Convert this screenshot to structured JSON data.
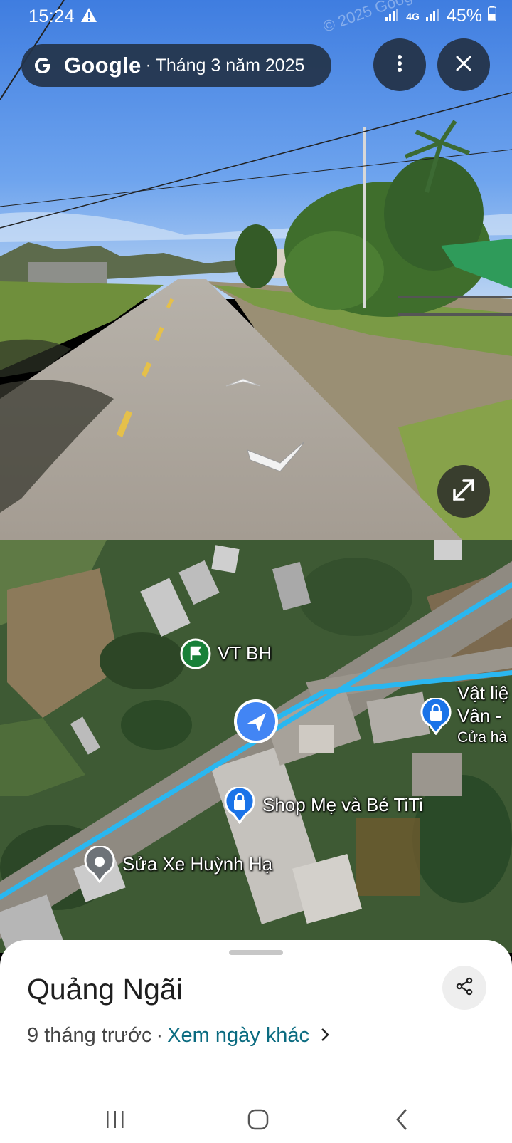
{
  "status_bar": {
    "time": "15:24",
    "battery_percent": "45%",
    "network_label": "4G"
  },
  "street_view": {
    "brand": "Google",
    "separator": "·",
    "capture_date": "Tháng 3 năm 2025",
    "watermark": "© 2025 Google",
    "controls": {
      "more_icon": "more-vert-icon",
      "close_icon": "close-icon",
      "expand_icon": "expand-icon"
    }
  },
  "map": {
    "route_color": "#2ab7f0",
    "places": [
      {
        "name": "VT BH",
        "type": "flag",
        "color": "#188038"
      },
      {
        "name": "Shop Mẹ và Bé TiTi",
        "type": "shopping",
        "color": "#1a73e8"
      },
      {
        "name": "Sửa Xe Huỳnh Hạ",
        "type": "generic",
        "color": "#5f6368"
      },
      {
        "name_line1": "Vật liệ",
        "name_line2": "Vân - ",
        "name_line3": "Cửa hà",
        "type": "shopping",
        "color": "#1a73e8"
      }
    ],
    "location_marker_icon": "navigation-arrow-icon"
  },
  "sheet": {
    "title": "Quảng Ngãi",
    "age": "9 tháng trước",
    "separator": "·",
    "other_dates_link": "Xem ngày khác",
    "share_icon": "share-icon"
  },
  "nav_bar": {
    "recent_icon": "recent-apps-icon",
    "home_icon": "home-icon",
    "back_icon": "back-icon"
  }
}
